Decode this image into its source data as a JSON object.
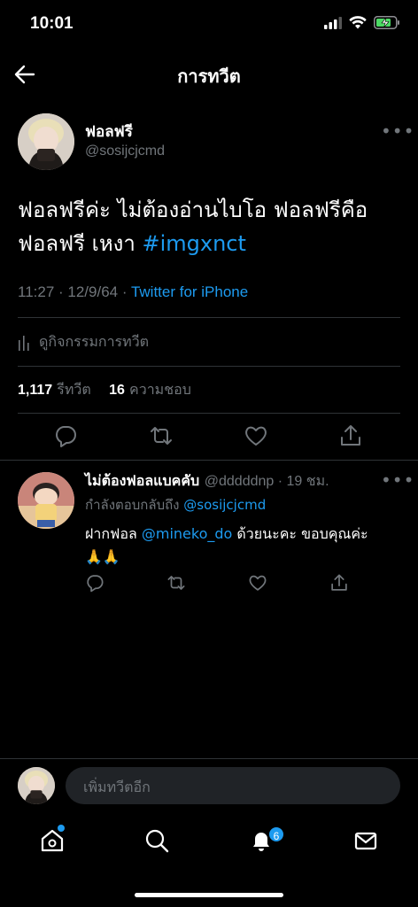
{
  "status_bar": {
    "time": "10:01"
  },
  "header": {
    "title": "การทวีต"
  },
  "tweet": {
    "author_name": "ฟอลฟรี",
    "author_handle": "@sosijcjcmd",
    "text_line1": "ฟอลฟรีค่ะ ไม่ต้องอ่านไบโอ ฟอลฟรีคือ",
    "text_line2_prefix": "ฟอลฟรี เหงา ",
    "hashtag": "#imgxnct",
    "time": "11:27",
    "date": "12/9/64",
    "source": "Twitter for iPhone",
    "activity_label": "ดูกิจกรรมการทวีต",
    "retweet_count": "1,117",
    "retweet_label": "รีทวีต",
    "like_count": "16",
    "like_label": "ความชอบ"
  },
  "reply": {
    "author_name": "ไม่ต้องฟอลแบคคับ",
    "author_handle": "@dddddnp",
    "time_ago": "19 ชม.",
    "replying_to_label": "กำลังตอบกลับถึง",
    "replying_to_handle": "@sosijcjcmd",
    "text_prefix": "ฝากฟอล ",
    "mention": "@mineko_do",
    "text_suffix": " ด้วยนะคะ ขอบคุณค่ะ",
    "emoji": "🙏🙏"
  },
  "compose": {
    "placeholder": "เพิ่มทวีตอีก"
  },
  "tabbar": {
    "notification_badge": "6"
  },
  "colors": {
    "accent": "#1d9bf0",
    "background": "#000000",
    "muted": "#71767b"
  }
}
